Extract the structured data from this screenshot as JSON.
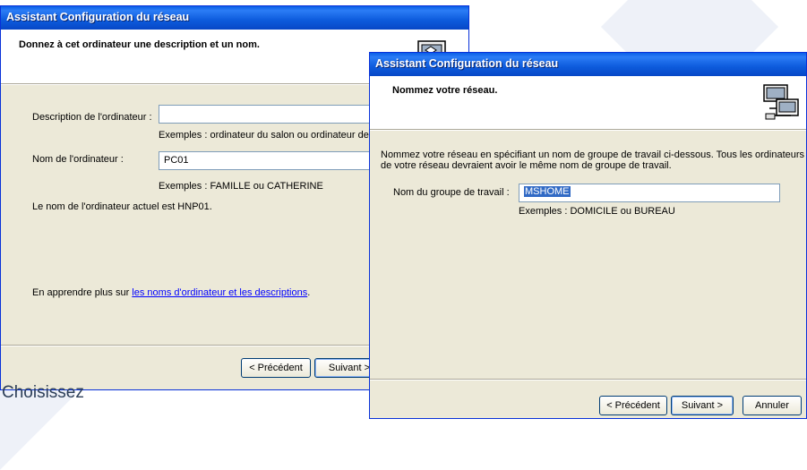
{
  "window_back": {
    "title": "Assistant Configuration du réseau",
    "header": "Donnez à cet ordinateur une description et un nom.",
    "description_label": "Description de l'ordinateur :",
    "description_value": "",
    "description_examples": "Exemples : ordinateur du salon ou ordinateur de C",
    "name_label": "Nom de l'ordinateur :",
    "name_value": "PC01",
    "name_examples": "Exemples : FAMILLE ou CATHERINE",
    "current_name": "Le nom de l'ordinateur actuel est HNP01.",
    "learn_prefix": "En apprendre plus sur ",
    "learn_link": "les noms d'ordinateur et les descriptions",
    "learn_suffix": ".",
    "back_button": "< Précédent",
    "next_button": "Suivant >"
  },
  "window_front": {
    "title": "Assistant Configuration du réseau",
    "header": "Nommez votre réseau.",
    "instructions_line1": "Nommez votre réseau en spécifiant un nom de groupe de travail ci-dessous. Tous les ordinateurs",
    "instructions_line2": "de votre réseau devraient avoir le même nom de groupe de travail.",
    "workgroup_label": "Nom du groupe de travail :",
    "workgroup_value": "MSHOME",
    "workgroup_examples": "Exemples : DOMICILE ou BUREAU",
    "back_button": "< Précédent",
    "next_button": "Suivant >",
    "cancel_button": "Annuler"
  },
  "caption": "Choisissez",
  "icons": {
    "network": "network-computers-icon"
  },
  "colors": {
    "titlebar": "#0a5fe8",
    "dialog": "#ece9d8",
    "selection": "#316ac5",
    "link": "#0000ff",
    "caption": "#2c3e58"
  }
}
